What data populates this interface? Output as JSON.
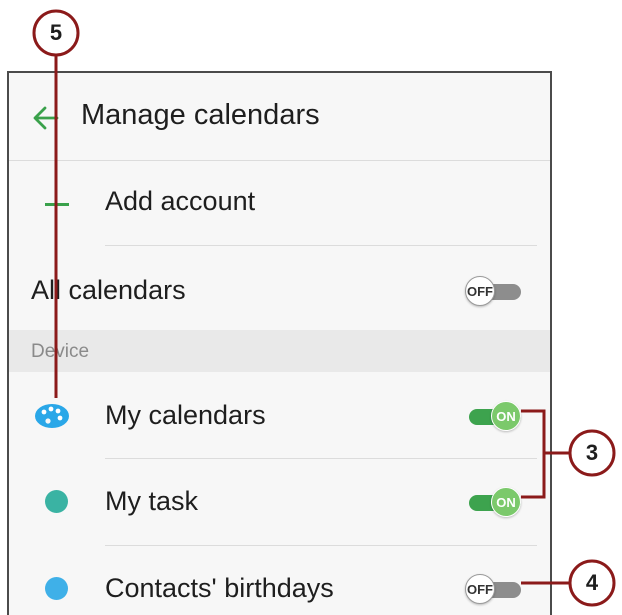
{
  "header": {
    "title": "Manage calendars",
    "back_icon": "arrow-left-icon"
  },
  "add_account": {
    "label": "Add account",
    "icon": "plus-icon"
  },
  "all_calendars": {
    "label": "All calendars",
    "toggle": "OFF"
  },
  "section": {
    "label": "Device"
  },
  "calendars": [
    {
      "label": "My calendars",
      "icon": "palette-icon",
      "color": "#2aa7e8",
      "toggle": "ON"
    },
    {
      "label": "My task",
      "icon": "dot-icon",
      "color": "#3ab3a3",
      "toggle": "ON"
    },
    {
      "label": "Contacts' birthdays",
      "icon": "dot-icon",
      "color": "#3fb0e8",
      "toggle": "OFF"
    }
  ],
  "callouts": {
    "c3": "3",
    "c4": "4",
    "c5": "5",
    "color": "#8b1a1a"
  },
  "colors": {
    "accent": "#3aa14b",
    "toggle_on": "#3da34e",
    "toggle_off": "#8d8d8d"
  }
}
